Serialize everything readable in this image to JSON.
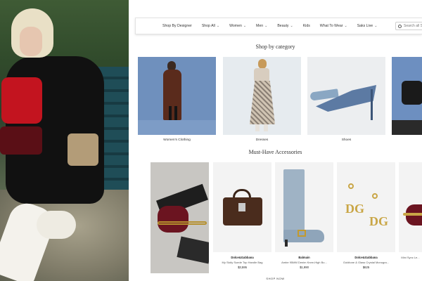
{
  "nav": {
    "items": [
      {
        "label": "Shop By Designer",
        "chevron": false
      },
      {
        "label": "Shop All",
        "chevron": true
      },
      {
        "label": "Women",
        "chevron": true
      },
      {
        "label": "Men",
        "chevron": true
      },
      {
        "label": "Beauty",
        "chevron": true
      },
      {
        "label": "Kids",
        "chevron": false
      },
      {
        "label": "What To Wear",
        "chevron": true
      },
      {
        "label": "Saks Live",
        "chevron": true
      }
    ],
    "search_placeholder": "Search all S"
  },
  "shop_by_category": {
    "title": "Shop by category",
    "items": [
      {
        "label": "Women's Clothing"
      },
      {
        "label": "Dresses"
      },
      {
        "label": "Shoes"
      },
      {
        "label": ""
      }
    ]
  },
  "accessories": {
    "title": "Must-Have Accessories",
    "items": [
      {
        "brand": "",
        "name": "",
        "price": ""
      },
      {
        "brand": "Dolce&Gabbana",
        "name": "My Sicily Suede Top Handle Bag",
        "price": "$3,595"
      },
      {
        "brand": "Balmain",
        "name": "Ambe 95MM Denim Knee-High Bo...",
        "price": "$1,990"
      },
      {
        "brand": "Dolce&Gabbana",
        "name": "Goldtone & Glass Crystal Monogra...",
        "price": "$625"
      },
      {
        "brand": "",
        "name": "Mini Sync Le...",
        "price": ""
      }
    ],
    "cta": "SHOP NOW"
  },
  "colors": {
    "accent": "#c3141f",
    "background": "#ffffff",
    "text": "#222222"
  }
}
